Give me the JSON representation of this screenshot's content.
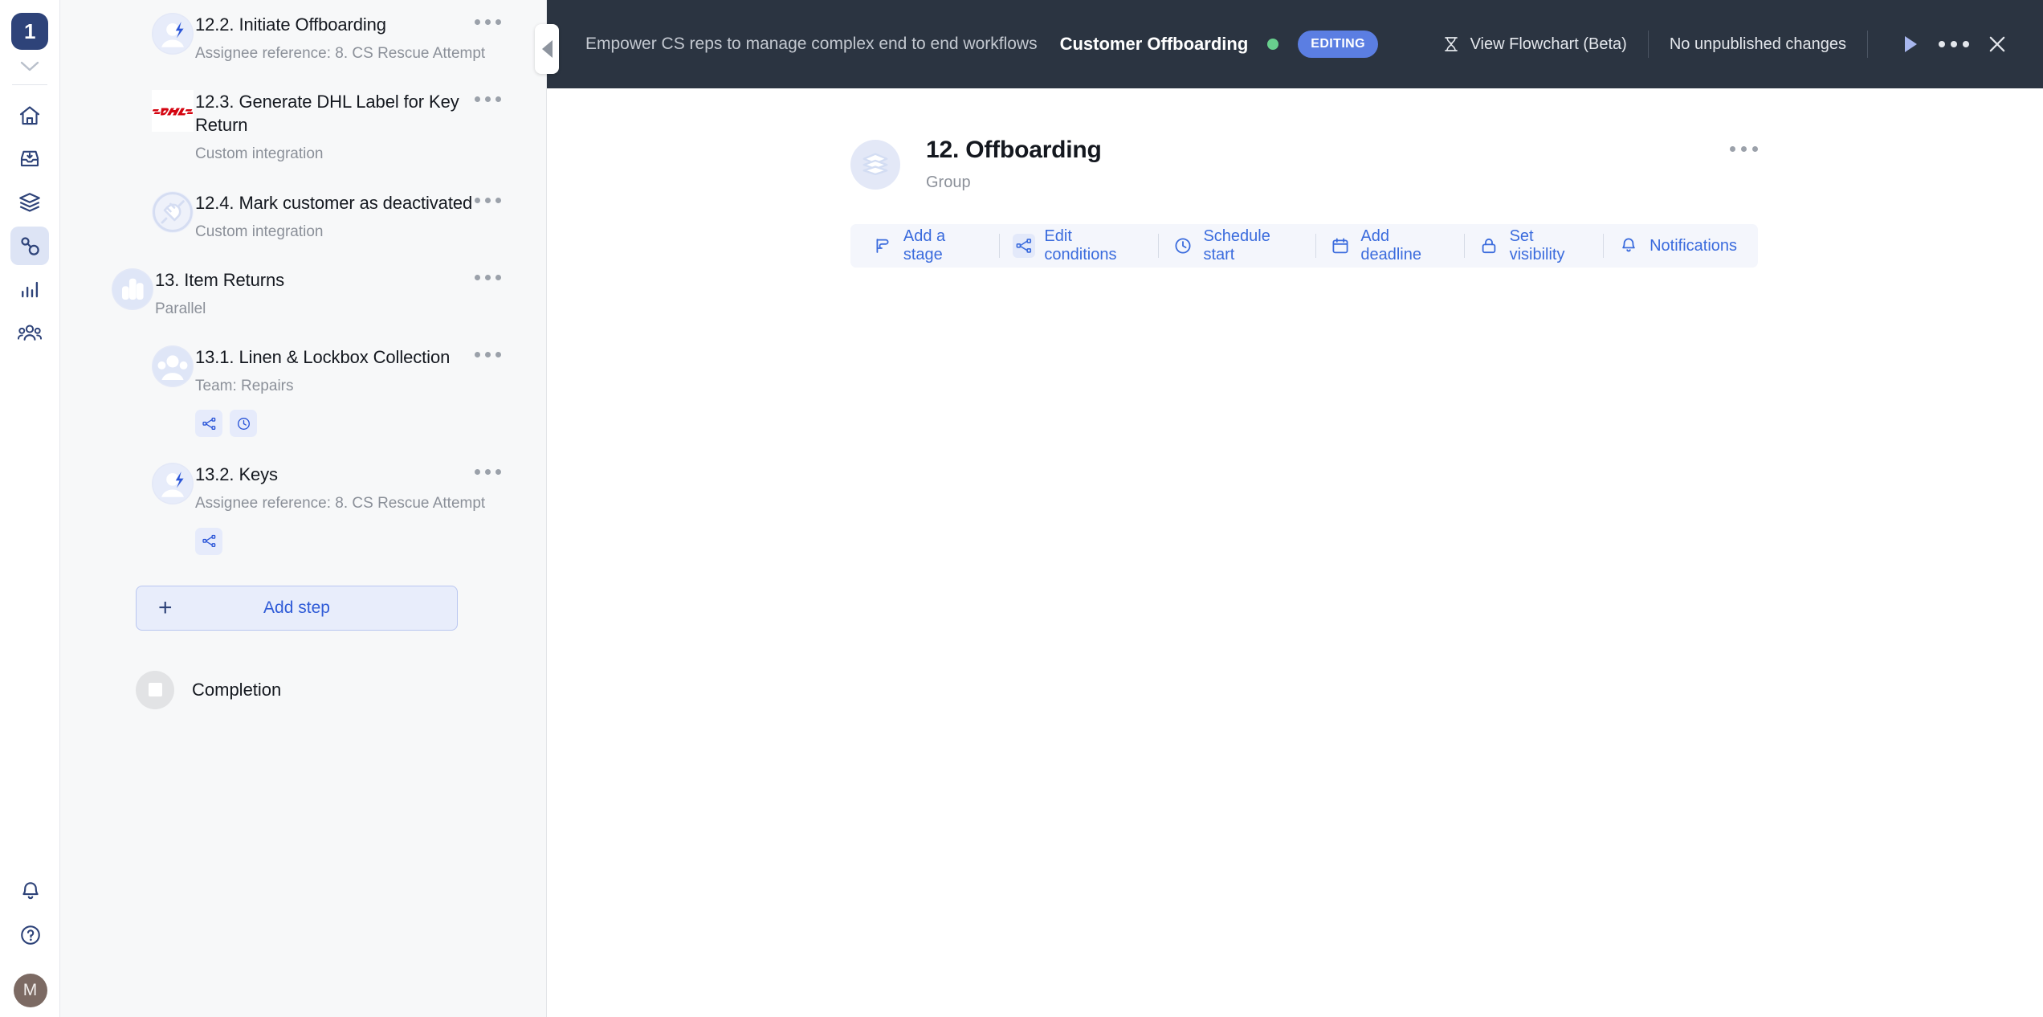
{
  "rail": {
    "logo_label": "1",
    "items": [
      {
        "name": "home",
        "label": "Home",
        "active": false
      },
      {
        "name": "inbox",
        "label": "Inbox",
        "active": false
      },
      {
        "name": "templates",
        "label": "Templates",
        "active": false
      },
      {
        "name": "workflows",
        "label": "Workflows",
        "active": true
      },
      {
        "name": "reports",
        "label": "Reports",
        "active": false
      },
      {
        "name": "people",
        "label": "People",
        "active": false
      }
    ],
    "notifications_label": "Notifications",
    "help_label": "Help",
    "avatar_initial": "M"
  },
  "header": {
    "breadcrumb": "Empower CS reps to manage complex end to end workflows",
    "title": "Customer Offboarding",
    "status_badge": "EDITING",
    "status_dot_color": "#68cf8d",
    "badge_color": "#5b7ee2",
    "flowchart_label": "View Flowchart (Beta)",
    "publish_status": "No unpublished changes",
    "run_label": "Run",
    "more_label": "More options",
    "close_label": "Close",
    "background_color": "#2b3441"
  },
  "steps": [
    {
      "title": "12.2. Initiate Offboarding",
      "subtitle": "Assignee reference: 8. CS Rescue Attempt",
      "icon": "assignee-lightning-icon",
      "indent": "child",
      "chips": []
    },
    {
      "title": "12.3. Generate DHL Label for Key Return",
      "subtitle": "Custom integration",
      "icon": "dhl-logo-icon",
      "indent": "child",
      "chips": []
    },
    {
      "title": "12.4. Mark customer as deactivated",
      "subtitle": "Custom integration",
      "icon": "plug-icon",
      "indent": "child",
      "chips": []
    },
    {
      "title": "13. Item Returns",
      "subtitle": "Parallel",
      "icon": "parallel-bars-icon",
      "indent": "root",
      "chips": []
    },
    {
      "title": "13.1. Linen & Lockbox Collection",
      "subtitle": "Team: Repairs",
      "icon": "team-icon",
      "indent": "child",
      "chips": [
        "conditions-icon",
        "clock-icon"
      ]
    },
    {
      "title": "13.2. Keys",
      "subtitle": "Assignee reference: 8. CS Rescue Attempt",
      "icon": "assignee-lightning-icon",
      "indent": "child",
      "chips": [
        "conditions-icon"
      ]
    }
  ],
  "sidebar": {
    "add_step_label": "Add step",
    "completion_label": "Completion"
  },
  "main": {
    "title": "12. Offboarding",
    "subtitle": "Group",
    "icon": "layers-icon",
    "more_label": "More options",
    "toolbar": [
      {
        "label": "Add a stage",
        "icon": "flag-icon",
        "highlighted": false
      },
      {
        "label": "Edit conditions",
        "icon": "conditions-icon",
        "highlighted": true
      },
      {
        "label": "Schedule start",
        "icon": "clock-icon",
        "highlighted": false
      },
      {
        "label": "Add deadline",
        "icon": "calendar-icon",
        "highlighted": false
      },
      {
        "label": "Set visibility",
        "icon": "lock-icon",
        "highlighted": false
      },
      {
        "label": "Notifications",
        "icon": "bell-icon",
        "highlighted": false
      }
    ]
  },
  "colors": {
    "accent_blue": "#3a6bdd",
    "navy": "#2e4379",
    "panel_bg": "#f7f8f9",
    "dhl_red": "#d40511"
  }
}
